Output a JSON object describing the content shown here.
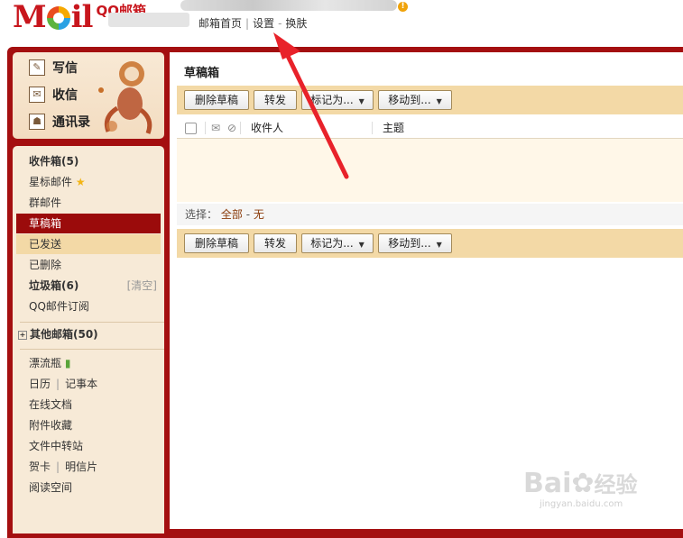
{
  "header": {
    "logo_text": "M",
    "logo_text2": "il",
    "app_name": "QQ邮箱",
    "links": [
      "邮箱首页",
      "设置",
      "换肤"
    ],
    "separators": [
      "|",
      "-"
    ]
  },
  "quick": {
    "items": [
      {
        "label": "写信",
        "icon": "compose-icon"
      },
      {
        "label": "收信",
        "icon": "inbox-icon"
      },
      {
        "label": "通讯录",
        "icon": "contacts-icon"
      }
    ]
  },
  "nav": {
    "inbox": "收件箱(5)",
    "starred": "星标邮件",
    "group": "群邮件",
    "drafts": "草稿箱",
    "sent": "已发送",
    "deleted": "已删除",
    "spam": "垃圾箱(6)",
    "spam_clear": "[清空]",
    "subscribe": "QQ邮件订阅",
    "other": "其他邮箱(50)",
    "drift": "漂流瓶",
    "calendar": "日历",
    "notes": "记事本",
    "docs": "在线文档",
    "attachments": "附件收藏",
    "transfer": "文件中转站",
    "cards": "贺卡",
    "postcards": "明信片",
    "reading": "阅读空间",
    "pipe": "|"
  },
  "content": {
    "folder_title": "草稿箱",
    "buttons": {
      "delete": "删除草稿",
      "forward": "转发",
      "mark": "标记为...",
      "move": "移动到..."
    },
    "columns": {
      "recipient": "收件人",
      "subject": "主题"
    },
    "select": {
      "label": "选择：",
      "all": "全部",
      "dash": "-",
      "none": "无"
    }
  },
  "watermark": {
    "brand": "Bai",
    "brand2": "经验",
    "url": "jingyan.baidu.com"
  },
  "colors": {
    "brand_red": "#a40f10",
    "selected_red": "#9b0b0b",
    "toolbar_tan": "#f3d9a6",
    "arrow_red": "#e8222a"
  }
}
